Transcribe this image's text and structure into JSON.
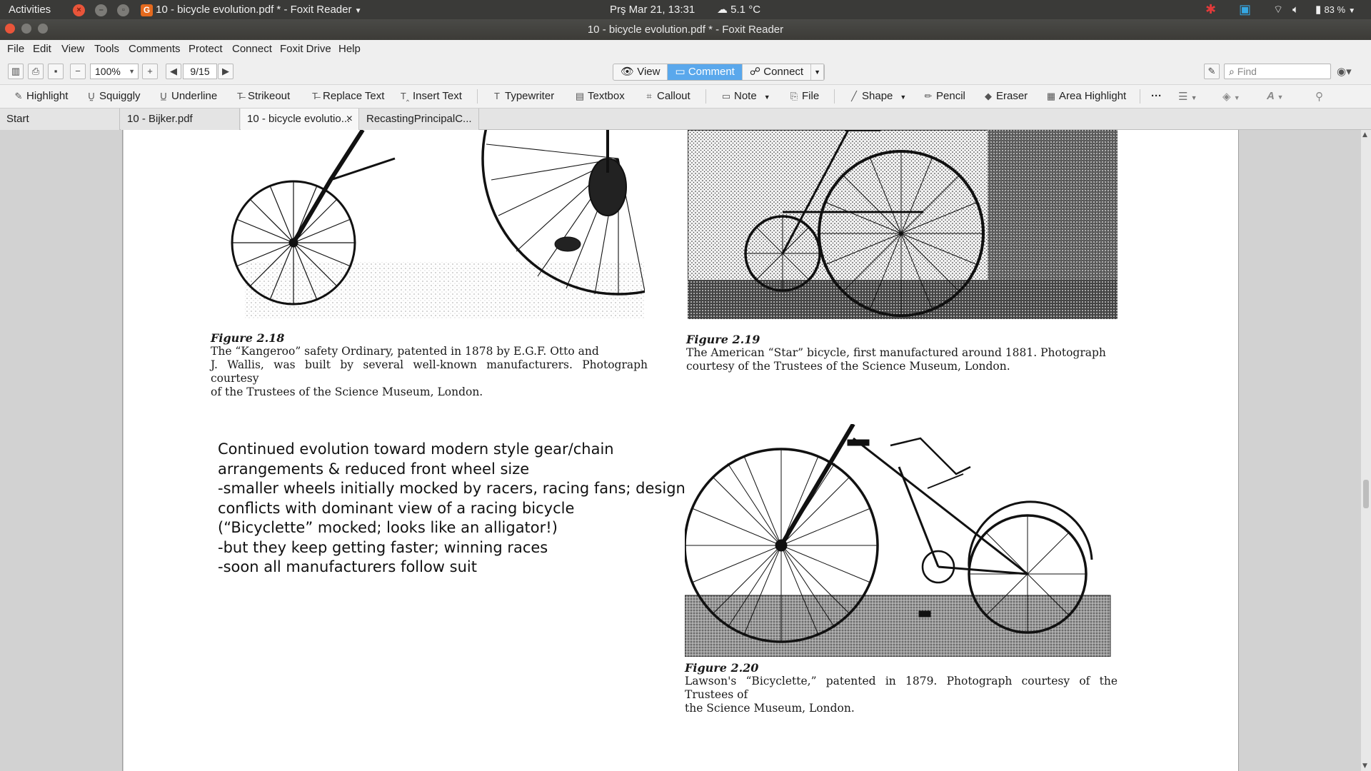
{
  "system_bar": {
    "activities": "Activities",
    "app_title": "10 - bicycle evolution.pdf * - Foxit Reader",
    "datetime": "Prş Mar 21, 13:31",
    "weather": "5.1 °C",
    "battery": "83 %"
  },
  "window": {
    "title": "10 - bicycle evolution.pdf * - Foxit Reader"
  },
  "menu": [
    "File",
    "Edit",
    "View",
    "Tools",
    "Comments",
    "Protect",
    "Connect",
    "Foxit Drive",
    "Help"
  ],
  "toolbar": {
    "zoom": "100%",
    "page": "9/15",
    "modes": [
      "View",
      "Comment",
      "Connect"
    ],
    "active_mode": "Comment",
    "find_placeholder": "Find"
  },
  "comment_tools": [
    "Highlight",
    "Squiggly",
    "Underline",
    "Strikeout",
    "Replace Text",
    "Insert Text",
    "Typewriter",
    "Textbox",
    "Callout",
    "Note",
    "File",
    "Shape",
    "Pencil",
    "Eraser",
    "Area Highlight"
  ],
  "tabs": [
    {
      "label": "Start"
    },
    {
      "label": "10 - Bijker.pdf"
    },
    {
      "label": "10 - bicycle evolutio..."
    },
    {
      "label": "RecastingPrincipalC..."
    }
  ],
  "document": {
    "figures": [
      {
        "number": "Figure 2.18",
        "caption_lines": [
          "The “Kangeroo” safety Ordinary, patented in 1878 by E.G.F. Otto and",
          "J. Wallis, was built by several well-known manufacturers. Photograph courtesy",
          "of the Trustees of the Science Museum, London."
        ]
      },
      {
        "number": "Figure 2.19",
        "caption_lines": [
          "The American “Star” bicycle, first manufactured around 1881. Photograph",
          "courtesy of the Trustees of the Science Museum, London."
        ]
      },
      {
        "number": "Figure 2.20",
        "caption_lines": [
          "Lawson's “Bicyclette,” patented in 1879. Photograph courtesy of the Trustees of",
          "the Science Museum, London."
        ]
      }
    ],
    "notes": [
      "Continued evolution toward modern style gear/chain",
      "arrangements & reduced front wheel size",
      "-smaller wheels initially mocked by racers, racing fans; design",
      "conflicts with dominant view of a racing bicycle",
      "(“Bicyclette” mocked; looks like an alligator!)",
      "-but they keep getting faster; winning races",
      "-soon all manufacturers follow suit"
    ]
  },
  "colors": {
    "topbar": "#3a3a38",
    "accent_active_mode": "#5aa8ec",
    "close_button": "#e9553a",
    "app_icon": "#e56a1e"
  }
}
